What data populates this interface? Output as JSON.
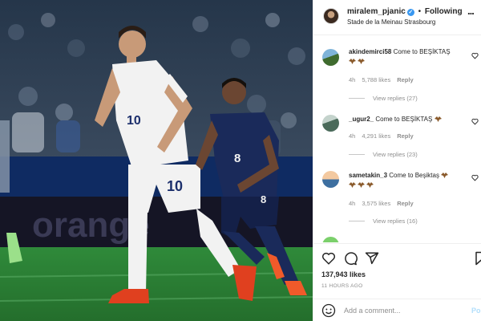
{
  "post": {
    "username": "miralem_pjanic",
    "separator": "•",
    "follow_label": "Following",
    "location": "Stade de la Meinau Strasbourg",
    "more_label": "..."
  },
  "photo": {
    "player_left_number": "10",
    "player_right_number": "8",
    "ad_board_text": "orange"
  },
  "comments": [
    {
      "username": "akindemirci58",
      "text": "Come to BEŞİKTAŞ",
      "emojis": 2,
      "age": "4h",
      "likes": "5,788 likes",
      "reply_label": "Reply",
      "view_replies": "View replies (27)"
    },
    {
      "username": "_ugur2_",
      "text": "Come to BEŞİKTAŞ",
      "emojis": 1,
      "age": "4h",
      "likes": "4,291 likes",
      "reply_label": "Reply",
      "view_replies": "View replies (23)"
    },
    {
      "username": "sametakin_3",
      "text": "Come to Beşiktaş",
      "emojis": 4,
      "age": "4h",
      "likes": "3,575 likes",
      "reply_label": "Reply",
      "view_replies": "View replies (16)"
    }
  ],
  "actions": {
    "like_count": "137,943 likes",
    "timestamp": "11 HOURS AGO"
  },
  "add_comment": {
    "placeholder": "Add a comment...",
    "post_label": "Po"
  },
  "icons": [
    "verified-icon",
    "more-icon",
    "heart-icon",
    "comment-icon",
    "share-icon",
    "bookmark-icon",
    "smiley-icon",
    "eagle-emoji-icon"
  ],
  "colors": {
    "link_blue": "#3897f0",
    "muted_text": "#8e8e8e",
    "post_button_disabled": "#b2dffc"
  }
}
